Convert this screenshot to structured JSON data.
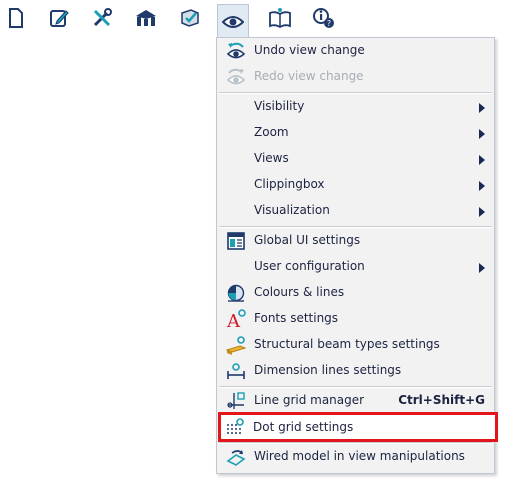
{
  "toolbar": {
    "buttons": [
      {
        "icon": "new-document-icon"
      },
      {
        "icon": "edit-document-icon"
      },
      {
        "icon": "tools-icon"
      },
      {
        "icon": "model-icon"
      },
      {
        "icon": "check-box-icon"
      },
      {
        "icon": "view-eye-icon"
      },
      {
        "icon": "open-book-icon"
      },
      {
        "icon": "help-info-icon"
      }
    ]
  },
  "menu": {
    "items": [
      {
        "label": "Undo view change",
        "enabled": true
      },
      {
        "label": "Redo view change",
        "enabled": false
      },
      {
        "label": "Visibility",
        "submenu": true
      },
      {
        "label": "Zoom",
        "submenu": true
      },
      {
        "label": "Views",
        "submenu": true
      },
      {
        "label": "Clippingbox",
        "submenu": true
      },
      {
        "label": "Visualization",
        "submenu": true
      },
      {
        "label": "Global UI settings"
      },
      {
        "label": "User configuration",
        "submenu": true
      },
      {
        "label": "Colours & lines"
      },
      {
        "label": "Fonts settings"
      },
      {
        "label": "Structural beam types settings"
      },
      {
        "label": "Dimension lines settings"
      },
      {
        "label": "Line grid manager",
        "shortcut": "Ctrl+Shift+G"
      },
      {
        "label": "Dot grid settings",
        "highlighted": true
      },
      {
        "label": "Wired model in view manipulations"
      }
    ]
  },
  "colors": {
    "icon_navy": "#1f3a6b",
    "icon_teal": "#1a9fb5",
    "highlight_border": "#e3141b",
    "menu_bg": "#f2f2f2"
  }
}
